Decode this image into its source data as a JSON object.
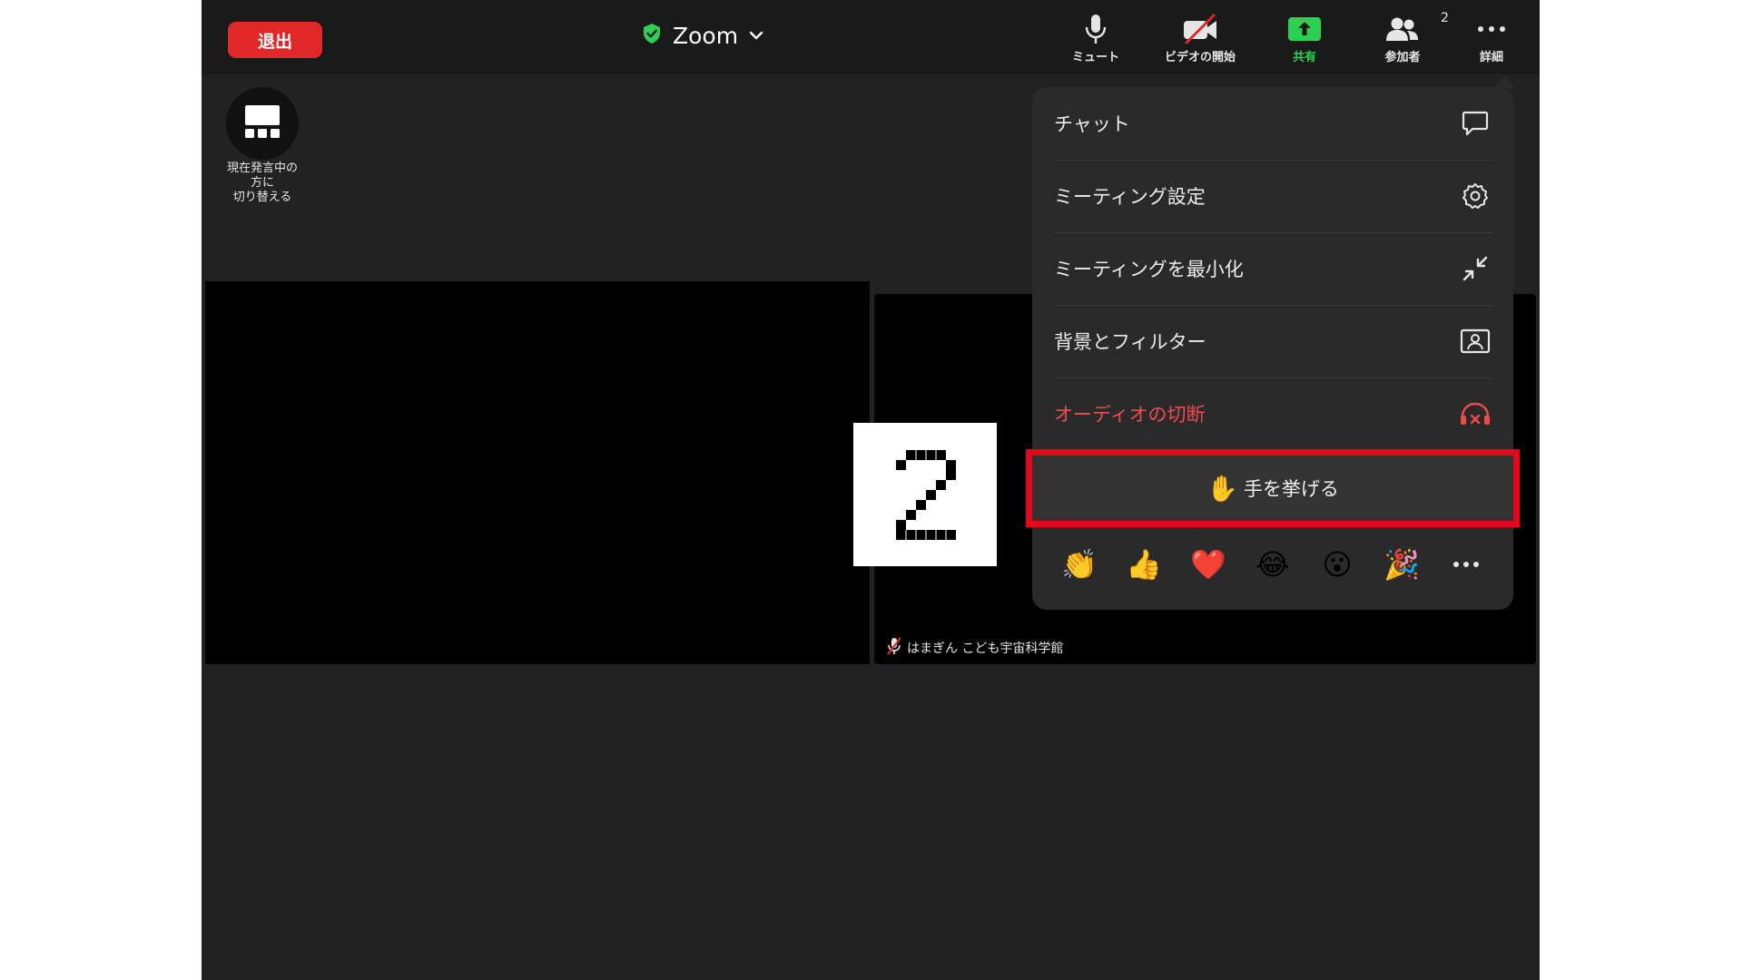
{
  "toolbar": {
    "leave_label": "退出",
    "app_title": "Zoom",
    "mute_label": "ミュート",
    "video_label": "ビデオの開始",
    "share_label": "共有",
    "participants_label": "参加者",
    "participants_count": "2",
    "more_label": "詳細"
  },
  "speaker_view": {
    "label_line1": "現在発言中の",
    "label_line2": "方に",
    "label_line3": "切り替える"
  },
  "tile": {
    "participant_name": "はまぎん こども宇宙科学館"
  },
  "step_badge": {
    "number": "2"
  },
  "menu": {
    "items": [
      {
        "label": "チャット",
        "icon": "chat-bubble-icon"
      },
      {
        "label": "ミーティング設定",
        "icon": "gear-icon"
      },
      {
        "label": "ミーティングを最小化",
        "icon": "minimize-arrows-icon"
      },
      {
        "label": "背景とフィルター",
        "icon": "portrait-frame-icon"
      },
      {
        "label": "オーディオの切断",
        "icon": "headphones-disconnect-icon"
      }
    ],
    "raise_hand": {
      "emoji": "✋",
      "label": "手を挙げる"
    },
    "reactions": [
      "👏",
      "👍",
      "❤️",
      "😂",
      "😮",
      "🎉"
    ]
  },
  "colors": {
    "leave": "#e02828",
    "share": "#2dd052",
    "danger": "#ef4b4b",
    "highlight": "#e4061a",
    "shield": "#2dd052"
  }
}
